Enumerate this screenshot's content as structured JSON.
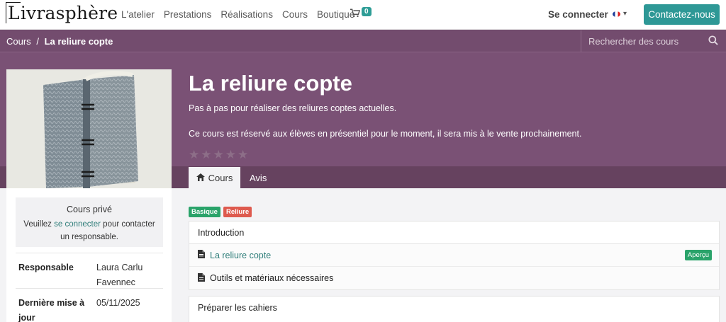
{
  "brand": {
    "logo_text": "Livrasphère"
  },
  "nav": {
    "links": [
      "L'atelier",
      "Prestations",
      "Réalisations",
      "Cours",
      "Boutique"
    ],
    "cart_count": "0",
    "signin_label": "Se connecter",
    "contact_label": "Contactez-nous"
  },
  "breadcrumb": {
    "parent": "Cours",
    "separator": "/",
    "current": "La reliure copte"
  },
  "search": {
    "placeholder": "Rechercher des cours"
  },
  "course": {
    "title": "La reliure copte",
    "description": "Pas à pas pour réaliser des reliures coptes actuelles.",
    "note": "Ce cours est réservé aux élèves en présentiel pour le moment, il sera mis à le vente prochainement.",
    "rating_stars": 0
  },
  "tabs": {
    "active": "Cours",
    "inactive": "Avis"
  },
  "sidebar": {
    "private_title": "Cours privé",
    "private_text_before": "Veuillez ",
    "private_link": "se connecter",
    "private_text_after": " pour contacter un responsable.",
    "rows": [
      {
        "label": "Responsable",
        "value": "Laura Carlu Favennec"
      },
      {
        "label": "Dernière mise à jour",
        "value": "05/11/2025"
      }
    ]
  },
  "tags": [
    "Basique",
    "Reliure"
  ],
  "sections": [
    {
      "title": "Introduction",
      "lessons": [
        {
          "name": "La reliure copte",
          "badge": "Aperçu"
        },
        {
          "name": "Outils et matériaux nécessaires",
          "badge": ""
        }
      ]
    },
    {
      "title": "Préparer les cahiers",
      "lessons": []
    }
  ],
  "colors": {
    "band": "#7a5175",
    "accent": "#2e9896",
    "tag_green": "#2aa36a",
    "tag_red": "#de5a4e"
  },
  "icons": [
    "cart-icon",
    "search-icon",
    "home-icon",
    "document-icon",
    "star-icon",
    "caret-down-icon"
  ]
}
